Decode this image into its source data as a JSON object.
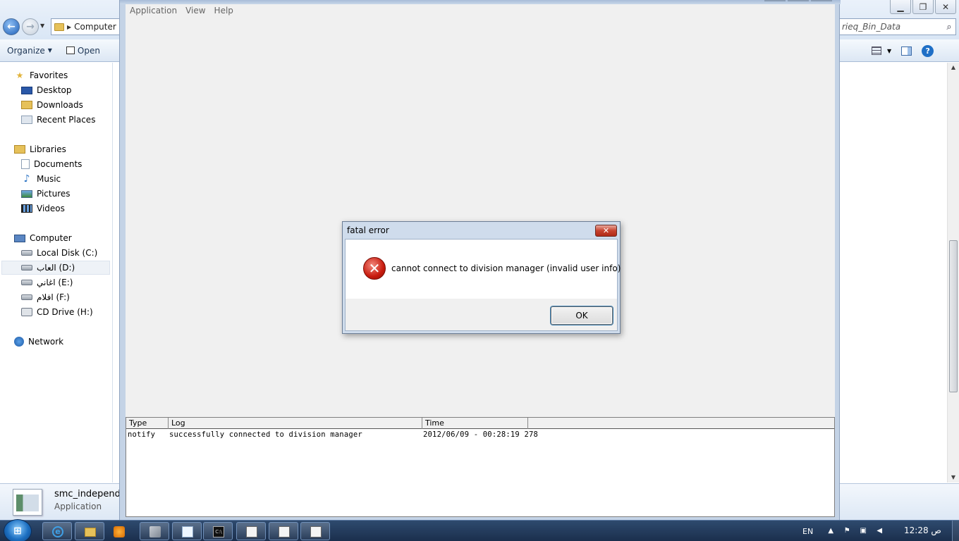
{
  "explorer": {
    "address_crumb": "Computer",
    "search_value": "rieq_Bin_Data",
    "toolbar": {
      "organize": "Organize",
      "open": "Open"
    },
    "nav": {
      "favorites": "Favorites",
      "desktop": "Desktop",
      "downloads": "Downloads",
      "recent": "Recent Places",
      "libraries": "Libraries",
      "documents": "Documents",
      "music": "Music",
      "pictures": "Pictures",
      "videos": "Videos",
      "computer": "Computer",
      "local_c": "Local Disk (C:)",
      "drive_d": "العاب (D:)",
      "drive_e": "اغاني (E:)",
      "drive_f": "افلام (F:)",
      "drive_h": "CD Drive (H:)",
      "network": "Network"
    },
    "details": {
      "name": "smc_independe",
      "type": "Application"
    }
  },
  "app": {
    "menu": {
      "application": "Application",
      "view": "View",
      "help": "Help"
    },
    "log": {
      "headers": {
        "type": "Type",
        "log": "Log",
        "time": "Time"
      },
      "rows": [
        {
          "type": "notify",
          "log": "successfully connected to division manager",
          "time": "2012/06/09 - 00:28:19 278"
        }
      ]
    }
  },
  "dialog": {
    "title": "fatal error",
    "message": "cannot connect to division manager (invalid user info)",
    "ok_label": "OK"
  },
  "taskbar": {
    "language": "EN",
    "clock": "12:28 ص"
  },
  "colors": {
    "error_red": "#c81b0e",
    "taskbar": "#1b2f4d",
    "explorer_chrome": "#dce7f4"
  }
}
